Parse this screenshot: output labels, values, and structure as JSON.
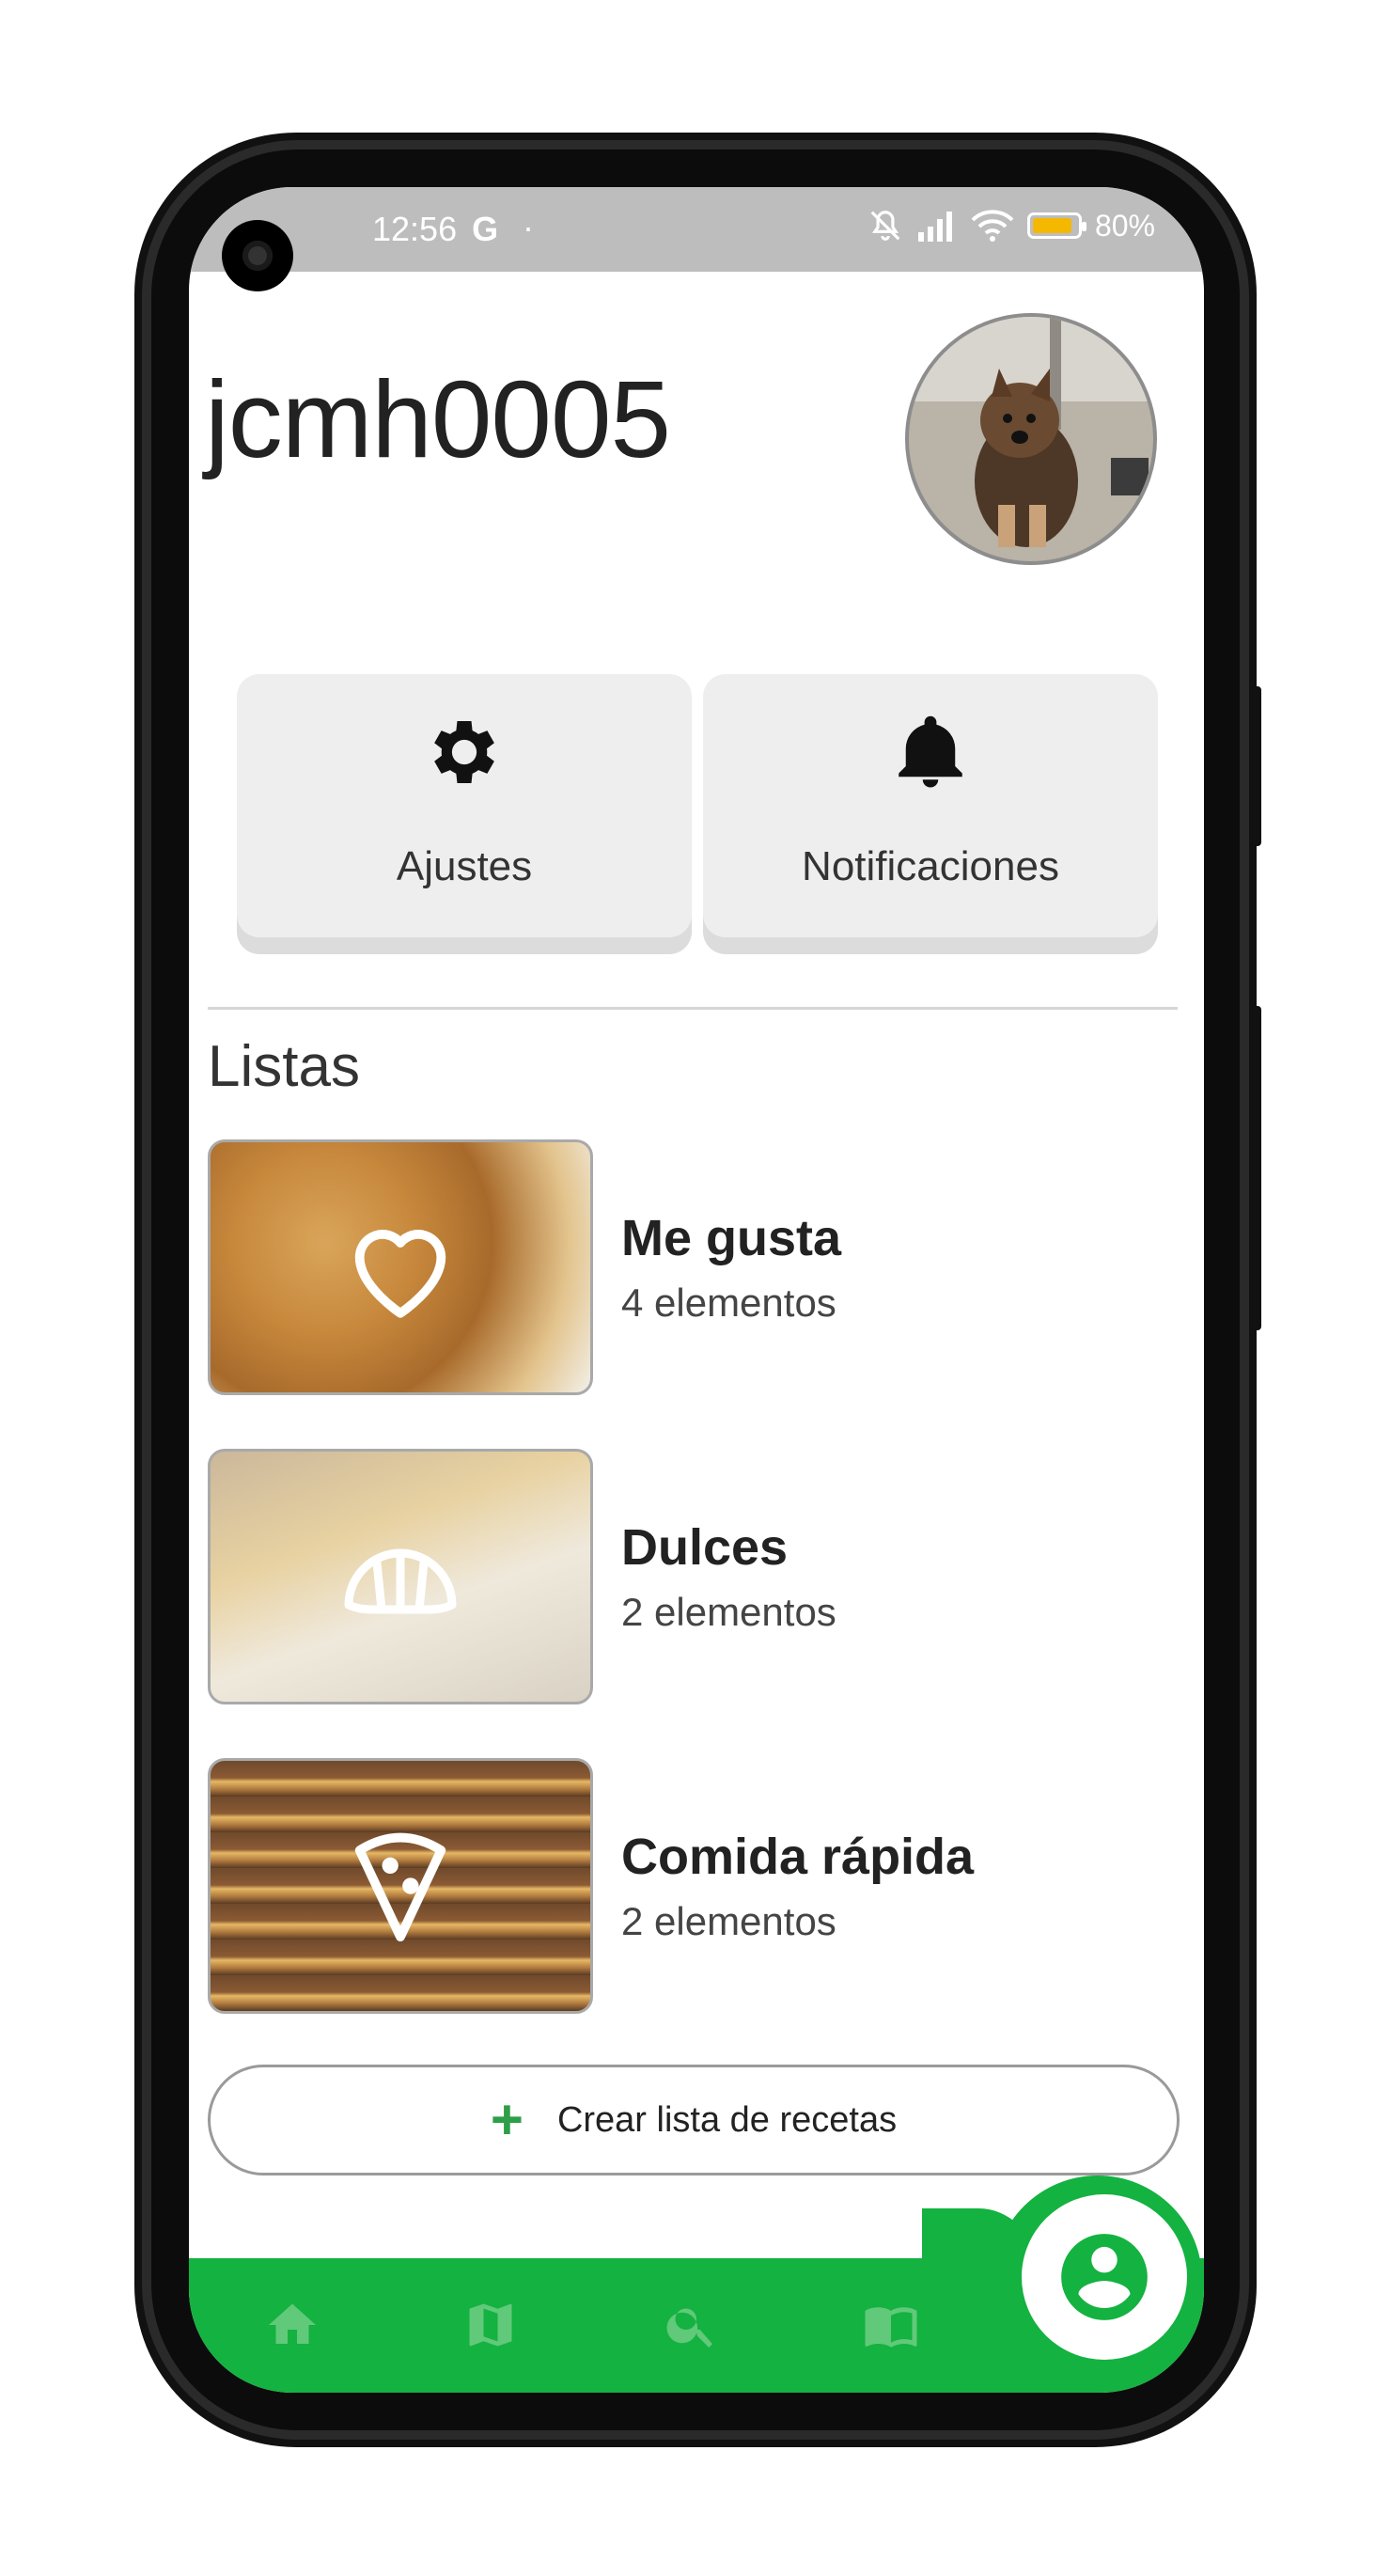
{
  "status_bar": {
    "time": "12:56",
    "g_badge": "G",
    "dot": "·",
    "battery": "80%",
    "battery_level": 0.8
  },
  "profile": {
    "username": "jcmh0005",
    "avatar_alt": "profile photo of a small dog"
  },
  "actions": [
    {
      "label": "Ajustes",
      "icon": "gear-icon"
    },
    {
      "label": "Notificaciones",
      "icon": "bell-icon"
    }
  ],
  "lists_section": {
    "title": "Listas",
    "items": [
      {
        "title": "Me gusta",
        "count": "4 elementos",
        "icon": "heart-icon"
      },
      {
        "title": "Dulces",
        "count": "2 elementos",
        "icon": "croissant-icon"
      },
      {
        "title": "Comida rápida",
        "count": "2 elementos",
        "icon": "pizza-icon"
      }
    ],
    "create_label": "Crear lista de recetas",
    "create_icon": "plus-icon"
  },
  "bottom_nav": {
    "items": [
      "home-icon",
      "map-icon",
      "search-icon",
      "book-icon",
      "profile-icon"
    ],
    "active": "profile-icon"
  },
  "colors": {
    "accent": "#14b240",
    "status_bar": "#bdbdbd"
  }
}
